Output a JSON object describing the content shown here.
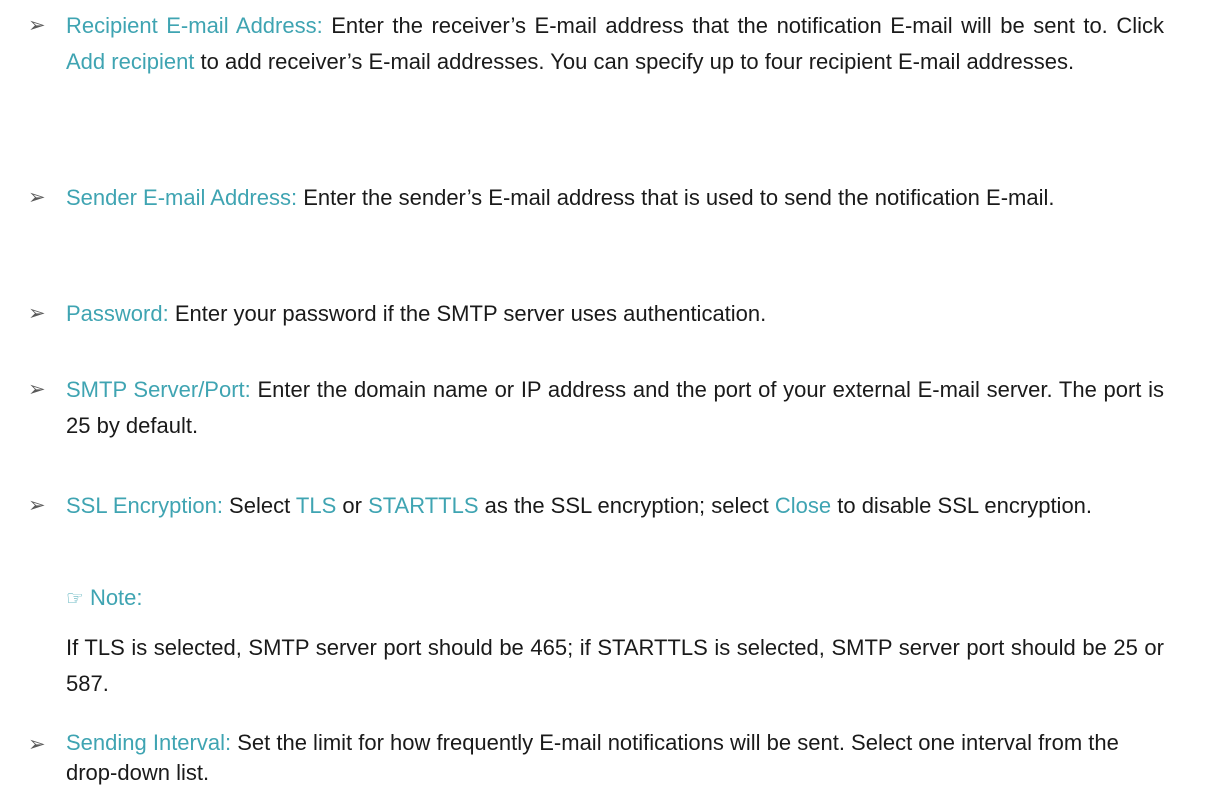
{
  "colors": {
    "accent": "#3fa4b2",
    "text": "#1a1a1a",
    "bullet": "#5a5a5a"
  },
  "bullet_glyph": "➢",
  "items": [
    {
      "term": "Recipient E-mail Address:",
      "text_a": " Enter the receiver’s E-mail address that the notification E-mail will be sent to. Click ",
      "link": "Add recipient",
      "text_b": " to add receiver’s E-mail addresses. You can specify up to four recipient E-mail addresses."
    },
    {
      "term": "Sender E-mail Address:",
      "text": " Enter the sender’s E-mail address that is used to send the notification E-mail."
    },
    {
      "term": "Password:",
      "text": " Enter your password if the SMTP server uses authentication."
    },
    {
      "term": "SMTP Server/Port:",
      "text": " Enter the domain name or IP address and the port of your external E-mail server. The port is 25 by default."
    },
    {
      "term": "SSL Encryption:",
      "text_a": " Select ",
      "opt1": "TLS",
      "text_b": " or ",
      "opt2": "STARTTLS",
      "text_c": " as the SSL encryption; select ",
      "opt3": "Close",
      "text_d": " to disable SSL encryption."
    },
    {
      "term": "Sending Interval:",
      "text": " Set the limit for how frequently E-mail notifications will be sent. Select one interval from the drop-down list."
    }
  ],
  "note": {
    "icon": "☞",
    "label": "Note:",
    "text": "If TLS is selected, SMTP server port should be 465; if STARTTLS is selected, SMTP server port should be 25 or 587."
  }
}
